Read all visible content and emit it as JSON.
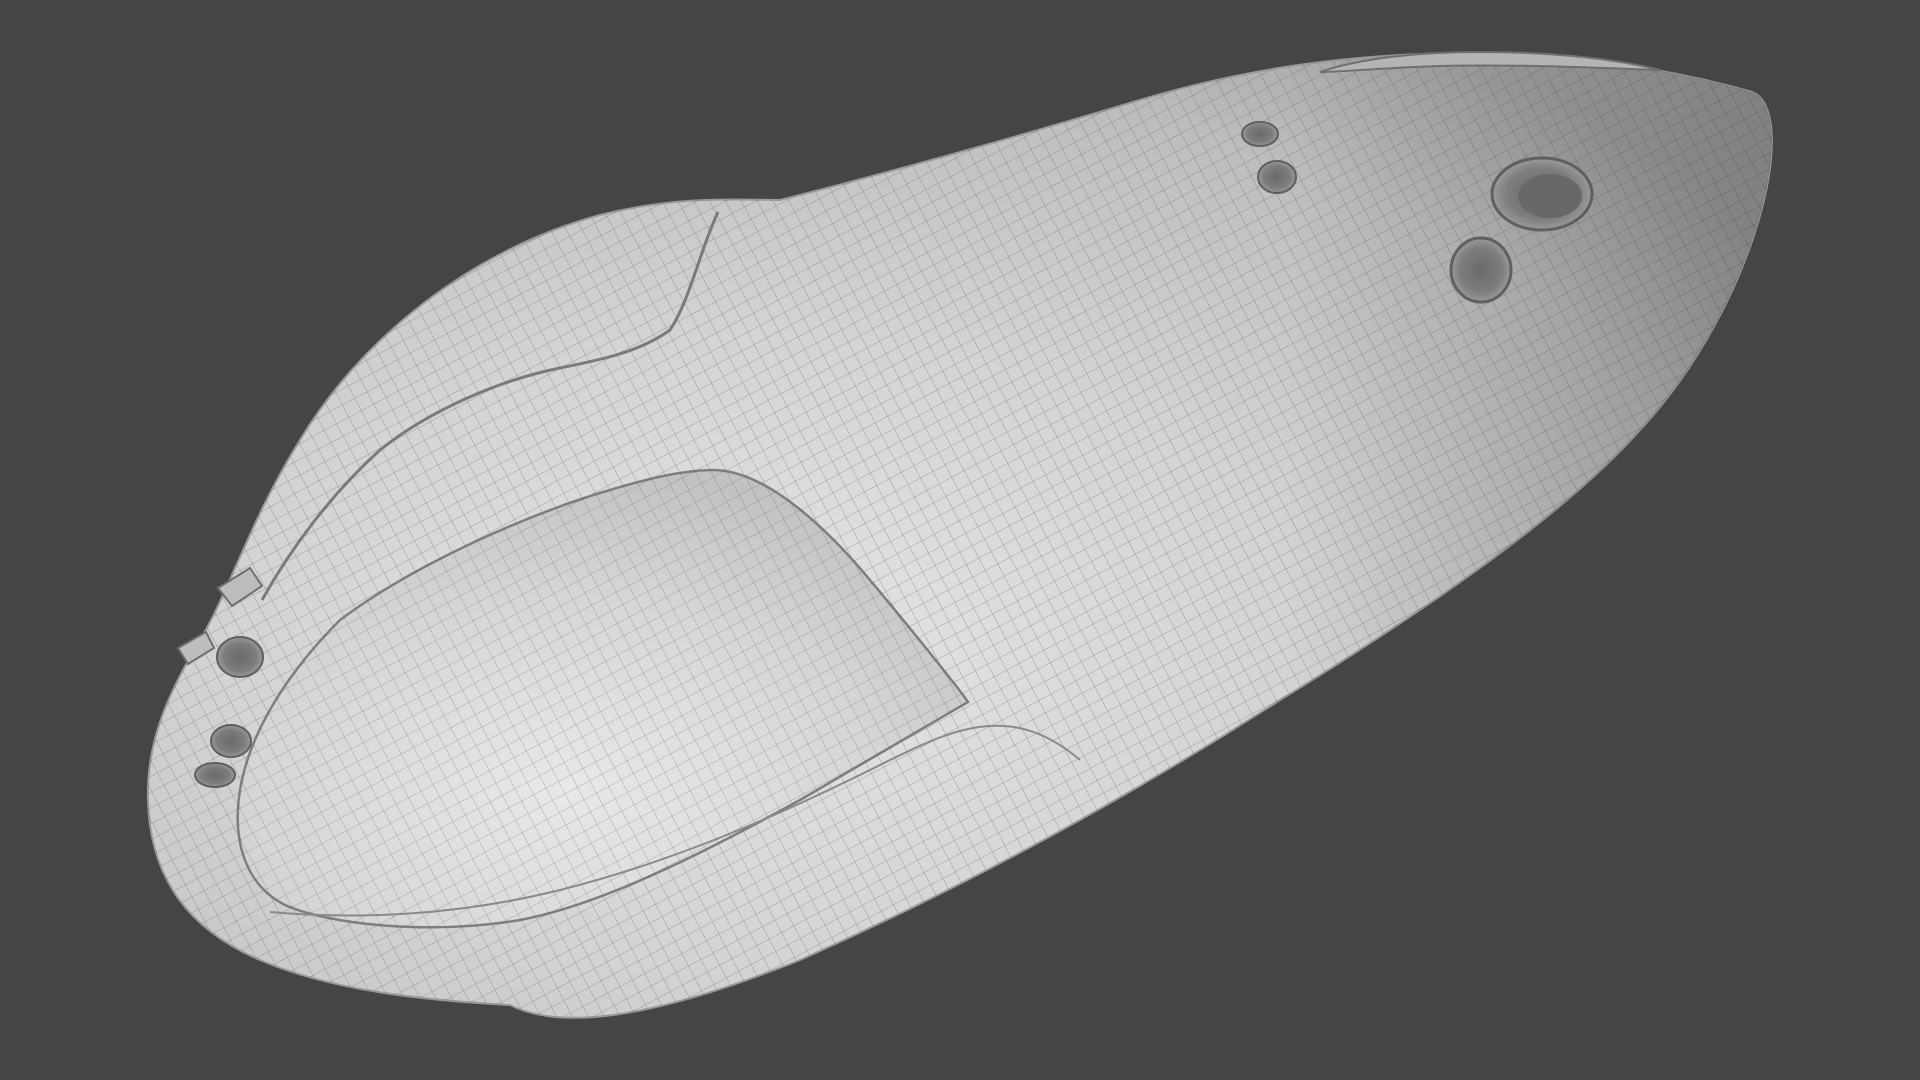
{
  "scene": {
    "background_color": "#454545",
    "surface_color": "#c9c9c9",
    "highlight_color": "#e6e6e6",
    "shadow_color": "#8a8a8a",
    "wire_color": "#4a4a4a"
  }
}
